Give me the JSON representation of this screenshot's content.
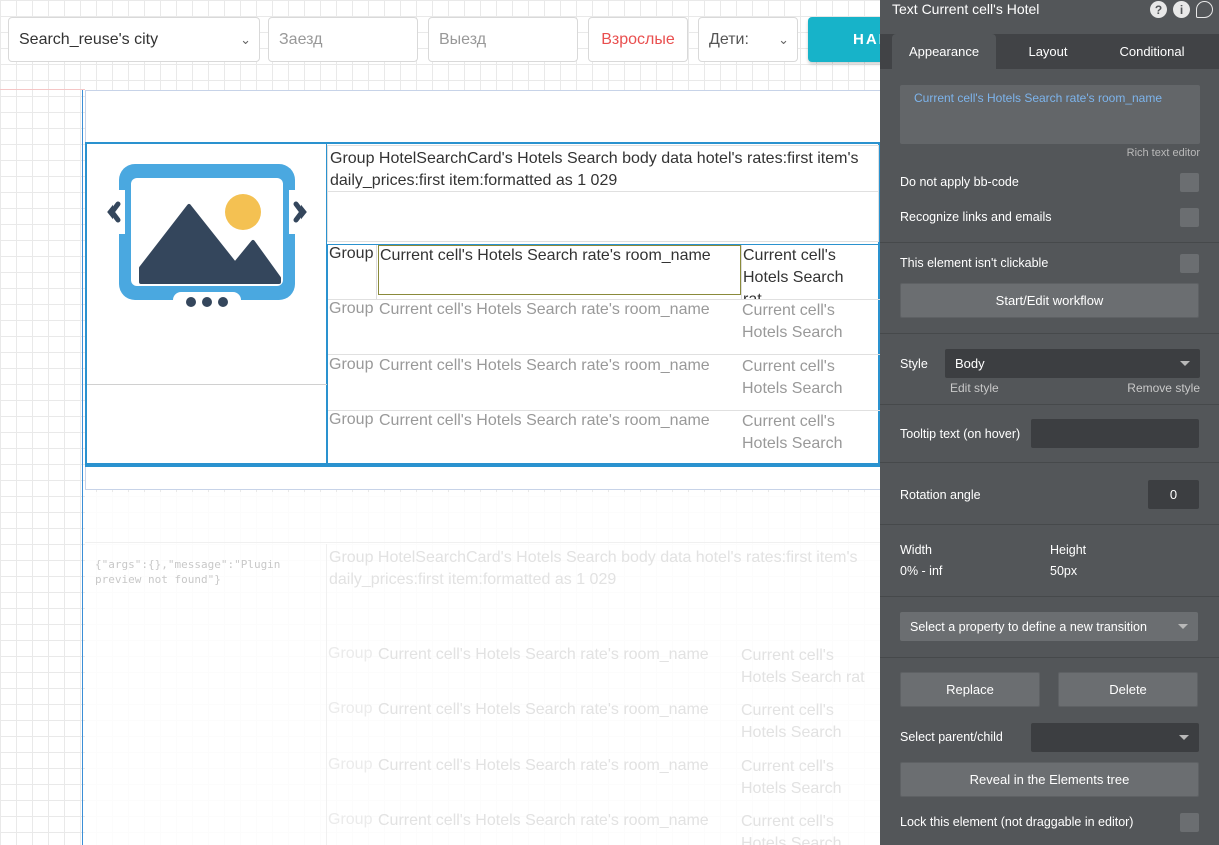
{
  "search_bar": {
    "city": "Search_reuse's city",
    "checkin_placeholder": "Заезд",
    "checkout_placeholder": "Выезд",
    "adults": "Взрослые",
    "children": "Дети:",
    "find_button": "НАЙ"
  },
  "card": {
    "rate_title": "Group HotelSearchCard's Hotels Search body data hotel's rates:first item's daily_prices:first item:formatted as 1 029",
    "rows": [
      {
        "group": "Group HotelID Hotel's",
        "room": "Current cell's Hotels Search rate's room_name",
        "hotel": "Current cell's Hotels Search rat..."
      },
      {
        "group": "Group HotelID Hotel's",
        "room": "Current cell's Hotels Search rate's room_name",
        "hotel": "Current cell's Hotels Search"
      },
      {
        "group": "Group HotelID Hotel's",
        "room": "Current cell's Hotels Search rate's room_name",
        "hotel": "Current cell's Hotels Search"
      },
      {
        "group": "Group HotelID Hotel's",
        "room": "Current cell's Hotels Search rate's room_name",
        "hotel": "Current cell's Hotels Search"
      }
    ]
  },
  "ghost_card": {
    "plugin_message": "{\"args\":{},\"message\":\"Plugin preview not found\"}",
    "rate_title": "Group HotelSearchCard's Hotels Search body data hotel's rates:first item's daily_prices:first item:formatted as 1 029",
    "rows": [
      {
        "group": "Group HotelID Hotel's",
        "room": "Current cell's Hotels Search rate's room_name",
        "hotel": "Current cell's Hotels Search rat"
      },
      {
        "group": "Group HotelID Hotel's",
        "room": "Current cell's Hotels Search rate's room_name",
        "hotel": "Current cell's Hotels Search"
      },
      {
        "group": "Group HotelID Hotel's",
        "room": "Current cell's Hotels Search rate's room_name",
        "hotel": "Current cell's Hotels Search"
      },
      {
        "group": "Group HotelID",
        "room": "Current cell's Hotels Search rate's room_name",
        "hotel": "Current cell's Hotels Search"
      }
    ]
  },
  "panel": {
    "title": "Text Current cell's Hotel",
    "help_icon": "?",
    "info_icon": "i",
    "tabs": [
      "Appearance",
      "Layout",
      "Conditional"
    ],
    "rich_text_value": "Current cell's Hotels Search rate's room_name",
    "rich_text_label": "Rich text editor",
    "do_not_apply_bbcode": "Do not apply bb-code",
    "recognize_links": "Recognize links and emails",
    "not_clickable": "This element isn't clickable",
    "workflow_button": "Start/Edit workflow",
    "style_label": "Style",
    "style_value": "Body",
    "edit_style": "Edit style",
    "remove_style": "Remove style",
    "tooltip_label": "Tooltip text (on hover)",
    "tooltip_value": "",
    "rotation_label": "Rotation angle",
    "rotation_value": "0",
    "width_label": "Width",
    "width_value": "0% - inf",
    "height_label": "Height",
    "height_value": "50px",
    "transition_placeholder": "Select a property to define a new transition",
    "replace_button": "Replace",
    "delete_button": "Delete",
    "select_parent_label": "Select parent/child",
    "reveal_button": "Reveal in the Elements tree",
    "lock_label": "Lock this element (not draggable in editor)"
  },
  "colors": {
    "accent": "#17b3c9",
    "selection": "#2a92cf",
    "panel_bg": "#535659",
    "rich_text": "#7db4ec"
  }
}
